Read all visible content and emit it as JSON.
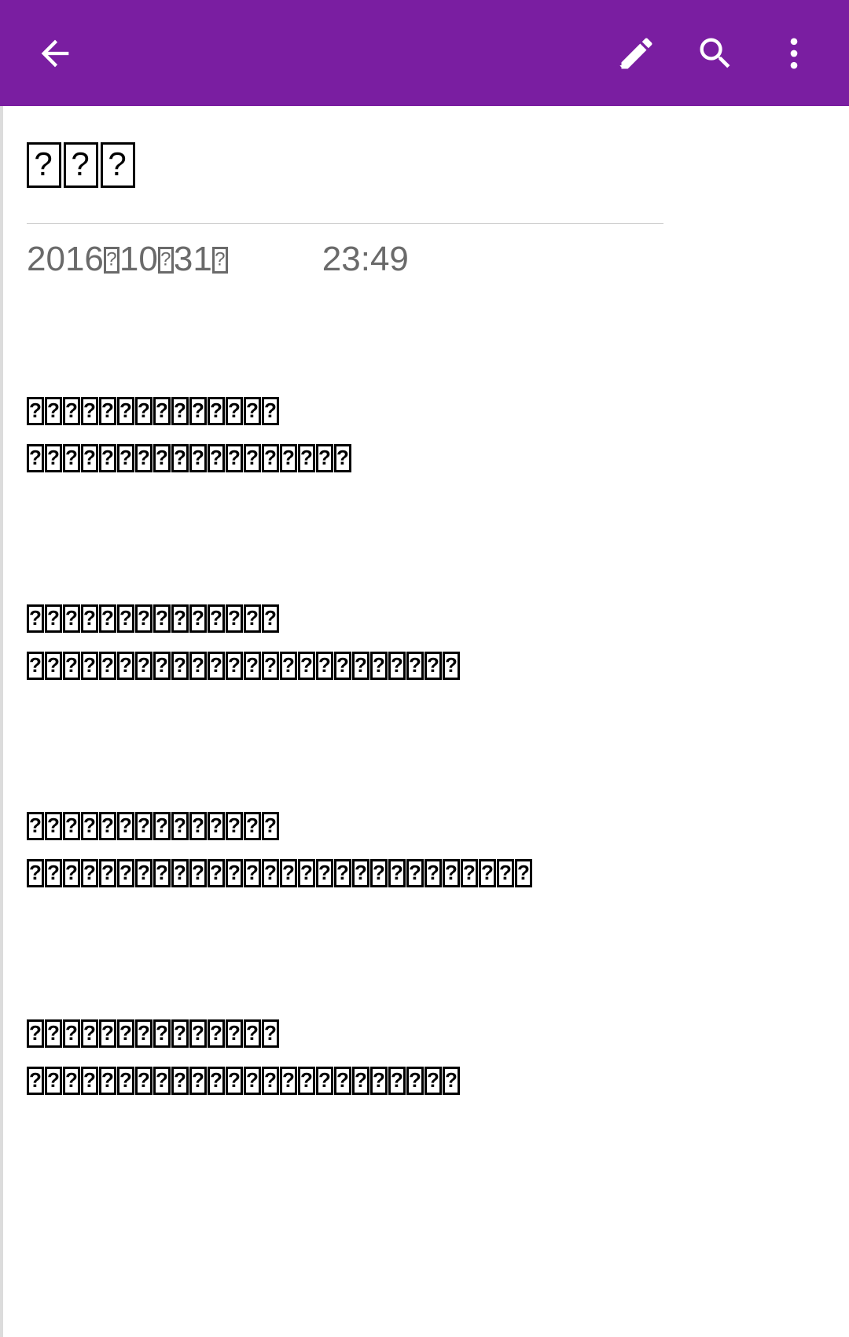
{
  "toolbar": {
    "back": "back",
    "edit": "edit",
    "search": "search",
    "more": "more"
  },
  "note": {
    "title_boxes": 3,
    "date_prefix": "2016",
    "date_mid": "10",
    "date_day": "31",
    "time": "23:49",
    "paragraphs": [
      [
        14,
        18
      ],
      [
        14,
        24
      ],
      [
        14,
        28
      ],
      [
        14,
        24
      ]
    ]
  }
}
